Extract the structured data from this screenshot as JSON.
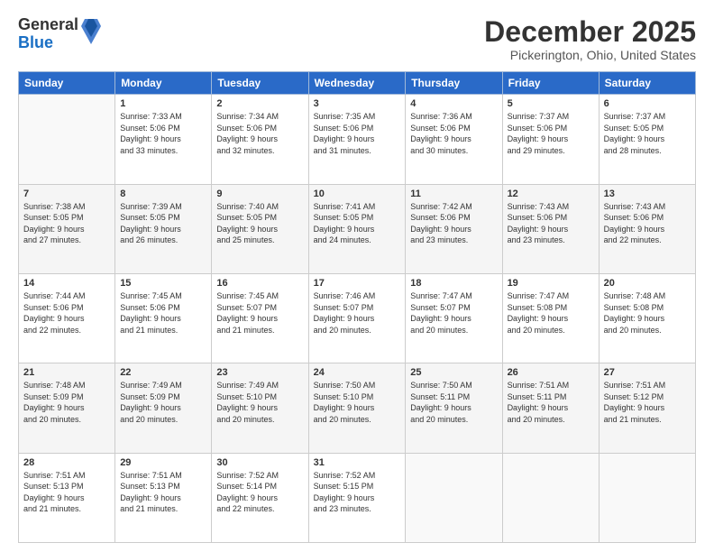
{
  "header": {
    "logo_general": "General",
    "logo_blue": "Blue",
    "title": "December 2025",
    "location": "Pickerington, Ohio, United States"
  },
  "calendar": {
    "days_of_week": [
      "Sunday",
      "Monday",
      "Tuesday",
      "Wednesday",
      "Thursday",
      "Friday",
      "Saturday"
    ],
    "weeks": [
      [
        {
          "day": "",
          "info": ""
        },
        {
          "day": "1",
          "info": "Sunrise: 7:33 AM\nSunset: 5:06 PM\nDaylight: 9 hours\nand 33 minutes."
        },
        {
          "day": "2",
          "info": "Sunrise: 7:34 AM\nSunset: 5:06 PM\nDaylight: 9 hours\nand 32 minutes."
        },
        {
          "day": "3",
          "info": "Sunrise: 7:35 AM\nSunset: 5:06 PM\nDaylight: 9 hours\nand 31 minutes."
        },
        {
          "day": "4",
          "info": "Sunrise: 7:36 AM\nSunset: 5:06 PM\nDaylight: 9 hours\nand 30 minutes."
        },
        {
          "day": "5",
          "info": "Sunrise: 7:37 AM\nSunset: 5:06 PM\nDaylight: 9 hours\nand 29 minutes."
        },
        {
          "day": "6",
          "info": "Sunrise: 7:37 AM\nSunset: 5:05 PM\nDaylight: 9 hours\nand 28 minutes."
        }
      ],
      [
        {
          "day": "7",
          "info": "Sunrise: 7:38 AM\nSunset: 5:05 PM\nDaylight: 9 hours\nand 27 minutes."
        },
        {
          "day": "8",
          "info": "Sunrise: 7:39 AM\nSunset: 5:05 PM\nDaylight: 9 hours\nand 26 minutes."
        },
        {
          "day": "9",
          "info": "Sunrise: 7:40 AM\nSunset: 5:05 PM\nDaylight: 9 hours\nand 25 minutes."
        },
        {
          "day": "10",
          "info": "Sunrise: 7:41 AM\nSunset: 5:05 PM\nDaylight: 9 hours\nand 24 minutes."
        },
        {
          "day": "11",
          "info": "Sunrise: 7:42 AM\nSunset: 5:06 PM\nDaylight: 9 hours\nand 23 minutes."
        },
        {
          "day": "12",
          "info": "Sunrise: 7:43 AM\nSunset: 5:06 PM\nDaylight: 9 hours\nand 23 minutes."
        },
        {
          "day": "13",
          "info": "Sunrise: 7:43 AM\nSunset: 5:06 PM\nDaylight: 9 hours\nand 22 minutes."
        }
      ],
      [
        {
          "day": "14",
          "info": "Sunrise: 7:44 AM\nSunset: 5:06 PM\nDaylight: 9 hours\nand 22 minutes."
        },
        {
          "day": "15",
          "info": "Sunrise: 7:45 AM\nSunset: 5:06 PM\nDaylight: 9 hours\nand 21 minutes."
        },
        {
          "day": "16",
          "info": "Sunrise: 7:45 AM\nSunset: 5:07 PM\nDaylight: 9 hours\nand 21 minutes."
        },
        {
          "day": "17",
          "info": "Sunrise: 7:46 AM\nSunset: 5:07 PM\nDaylight: 9 hours\nand 20 minutes."
        },
        {
          "day": "18",
          "info": "Sunrise: 7:47 AM\nSunset: 5:07 PM\nDaylight: 9 hours\nand 20 minutes."
        },
        {
          "day": "19",
          "info": "Sunrise: 7:47 AM\nSunset: 5:08 PM\nDaylight: 9 hours\nand 20 minutes."
        },
        {
          "day": "20",
          "info": "Sunrise: 7:48 AM\nSunset: 5:08 PM\nDaylight: 9 hours\nand 20 minutes."
        }
      ],
      [
        {
          "day": "21",
          "info": "Sunrise: 7:48 AM\nSunset: 5:09 PM\nDaylight: 9 hours\nand 20 minutes."
        },
        {
          "day": "22",
          "info": "Sunrise: 7:49 AM\nSunset: 5:09 PM\nDaylight: 9 hours\nand 20 minutes."
        },
        {
          "day": "23",
          "info": "Sunrise: 7:49 AM\nSunset: 5:10 PM\nDaylight: 9 hours\nand 20 minutes."
        },
        {
          "day": "24",
          "info": "Sunrise: 7:50 AM\nSunset: 5:10 PM\nDaylight: 9 hours\nand 20 minutes."
        },
        {
          "day": "25",
          "info": "Sunrise: 7:50 AM\nSunset: 5:11 PM\nDaylight: 9 hours\nand 20 minutes."
        },
        {
          "day": "26",
          "info": "Sunrise: 7:51 AM\nSunset: 5:11 PM\nDaylight: 9 hours\nand 20 minutes."
        },
        {
          "day": "27",
          "info": "Sunrise: 7:51 AM\nSunset: 5:12 PM\nDaylight: 9 hours\nand 21 minutes."
        }
      ],
      [
        {
          "day": "28",
          "info": "Sunrise: 7:51 AM\nSunset: 5:13 PM\nDaylight: 9 hours\nand 21 minutes."
        },
        {
          "day": "29",
          "info": "Sunrise: 7:51 AM\nSunset: 5:13 PM\nDaylight: 9 hours\nand 21 minutes."
        },
        {
          "day": "30",
          "info": "Sunrise: 7:52 AM\nSunset: 5:14 PM\nDaylight: 9 hours\nand 22 minutes."
        },
        {
          "day": "31",
          "info": "Sunrise: 7:52 AM\nSunset: 5:15 PM\nDaylight: 9 hours\nand 23 minutes."
        },
        {
          "day": "",
          "info": ""
        },
        {
          "day": "",
          "info": ""
        },
        {
          "day": "",
          "info": ""
        }
      ]
    ]
  }
}
